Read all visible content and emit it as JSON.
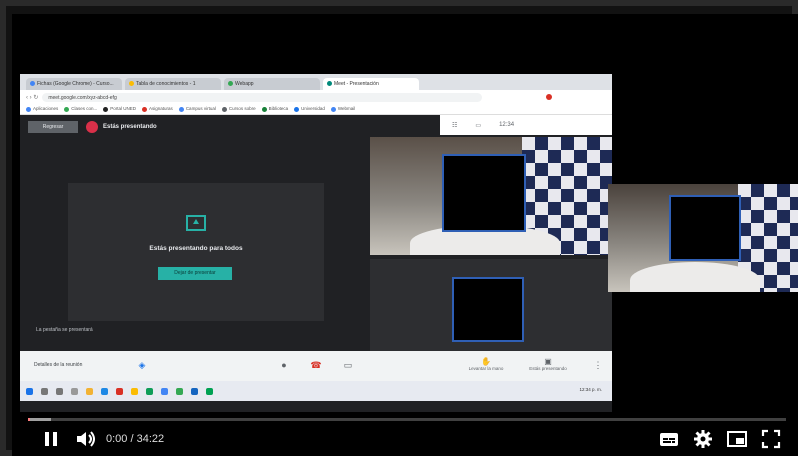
{
  "player": {
    "time_current": "0:00",
    "time_separator": " / ",
    "time_total": "34:22",
    "progress_fraction": 0.002
  },
  "browser": {
    "tabs": [
      "Fichas (Google Chrome) - Curso...",
      "Tabla de conocimientos - 1",
      "Webapp",
      "Meet - Presentación"
    ],
    "url": "meet.google.com/xyz-abcd-efg",
    "bookmarks": [
      "Aplicaciones",
      "Clases con...",
      "Portal UNED",
      "Asignaturas",
      "Campus virtual",
      "Cursos sobre",
      "Biblioteca",
      "Universidad",
      "Webmail"
    ]
  },
  "meet": {
    "header_button": "Regresar",
    "presenting_label": "Estás presentando",
    "tool_labels": [
      "",
      "",
      "12:34"
    ],
    "present_card_text": "Estás presentando para todos",
    "stop_button": "Dejar de presentar",
    "lower_note": "La pestaña se presentará",
    "meeting_details": "Detalles de la reunión",
    "raise_hand": "Levantar la mano",
    "present_now": "Estás presentando",
    "tray_text": "12:34 p. m."
  },
  "colors": {
    "accent_teal": "#27b1a6",
    "progress_red": "#ff0000",
    "redaction_border": "#2f5fb5"
  }
}
